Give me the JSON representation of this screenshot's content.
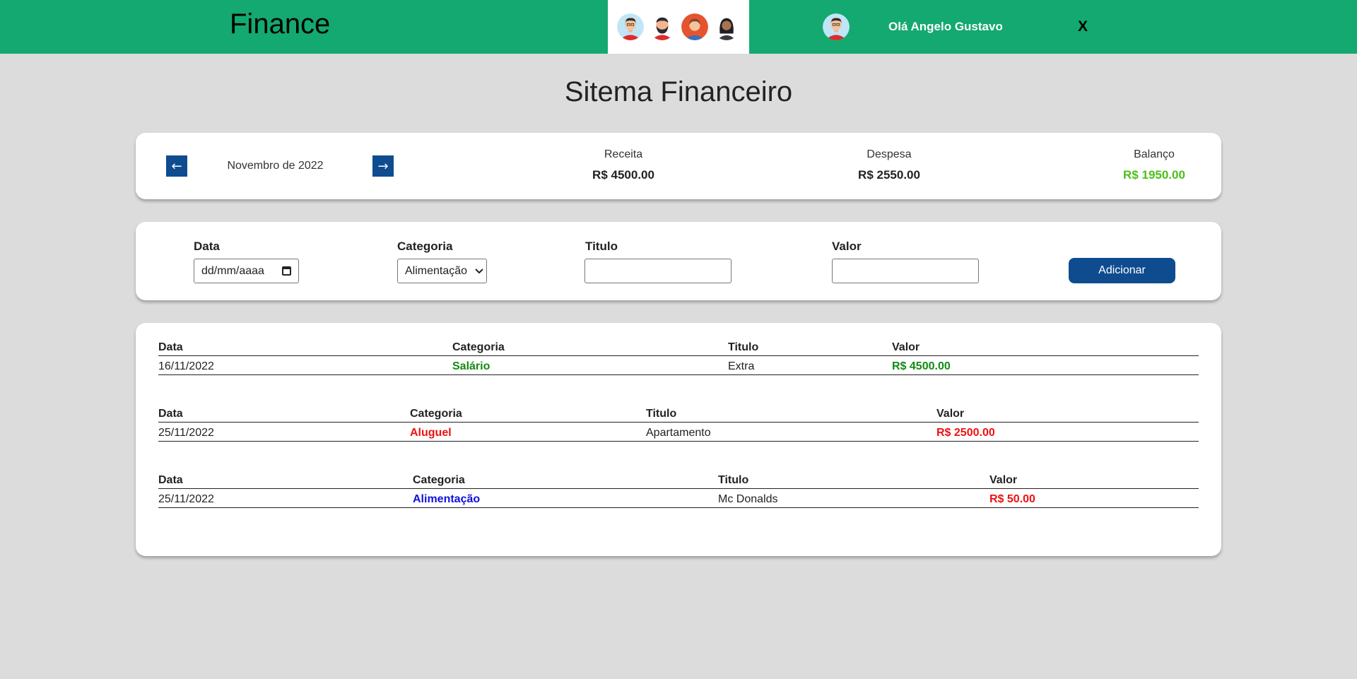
{
  "header": {
    "brand": "Finance",
    "greeting": "Olá Angelo Gustavo",
    "close_label": "X",
    "avatars": [
      "avatar-red-shirt",
      "avatar-bearded",
      "avatar-woman",
      "avatar-dark"
    ]
  },
  "page_title": "Sitema Financeiro",
  "summary": {
    "month": "Novembro de 2022",
    "prev_icon": "←",
    "next_icon": "→",
    "receita_label": "Receita",
    "receita_value": "R$ 4500.00",
    "despesa_label": "Despesa",
    "despesa_value": "R$ 2550.00",
    "balanco_label": "Balanço",
    "balanco_value": "R$ 1950.00"
  },
  "form": {
    "data_label": "Data",
    "data_placeholder": "dd/mm/aaaa",
    "categoria_label": "Categoria",
    "categoria_selected": "Alimentação",
    "titulo_label": "Titulo",
    "valor_label": "Valor",
    "add_label": "Adicionar"
  },
  "transactions": [
    {
      "headers": {
        "data": "Data",
        "categoria": "Categoria",
        "titulo": "Titulo",
        "valor": "Valor"
      },
      "data": "16/11/2022",
      "categoria": "Salário",
      "titulo": "Extra",
      "valor": "R$ 4500.00"
    },
    {
      "headers": {
        "data": "Data",
        "categoria": "Categoria",
        "titulo": "Titulo",
        "valor": "Valor"
      },
      "data": "25/11/2022",
      "categoria": "Aluguel",
      "titulo": "Apartamento",
      "valor": "R$ 2500.00"
    },
    {
      "headers": {
        "data": "Data",
        "categoria": "Categoria",
        "titulo": "Titulo",
        "valor": "Valor"
      },
      "data": "25/11/2022",
      "categoria": "Alimentação",
      "titulo": "Mc Donalds",
      "valor": "R$ 50.00"
    }
  ],
  "colors": {
    "header_green": "#13a970",
    "accent_blue": "#0f4c8f",
    "income_green": "#138a13",
    "balance_green": "#4cc01a",
    "expense_red": "#ee1111",
    "food_blue": "#1010dd"
  }
}
